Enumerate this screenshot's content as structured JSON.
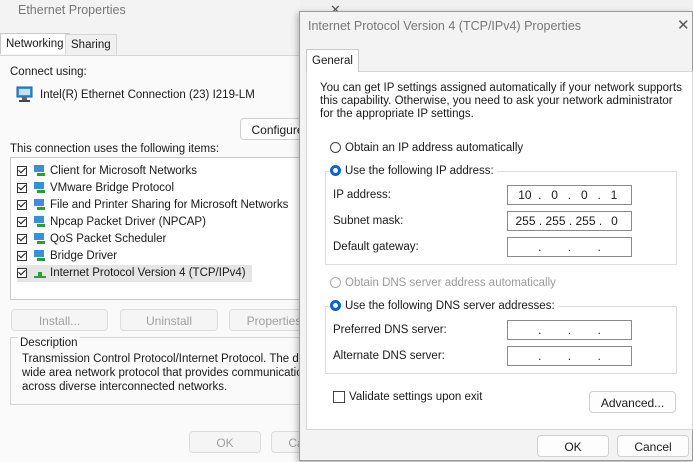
{
  "eth": {
    "title": "Ethernet Properties",
    "close_glyph": "✕",
    "tabs": [
      "Networking",
      "Sharing"
    ],
    "connect_using_label": "Connect using:",
    "adapter_name": "Intel(R) Ethernet Connection (23) I219-LM",
    "configure_label": "Configure",
    "items_label": "This connection uses the following items:",
    "items": [
      {
        "label": "Client for Microsoft Networks",
        "checked": true
      },
      {
        "label": "VMware Bridge Protocol",
        "checked": true
      },
      {
        "label": "File and Printer Sharing for Microsoft Networks",
        "checked": true
      },
      {
        "label": "Npcap Packet Driver (NPCAP)",
        "checked": true
      },
      {
        "label": "QoS Packet Scheduler",
        "checked": true
      },
      {
        "label": "Bridge Driver",
        "checked": true
      },
      {
        "label": "Internet Protocol Version 4 (TCP/IPv4)",
        "checked": true
      }
    ],
    "install_label": "Install...",
    "uninstall_label": "Uninstall",
    "properties_label": "Properties",
    "description_title": "Description",
    "description_lines": [
      "Transmission Control Protocol/Internet Protocol. The default",
      "wide area network protocol that provides communication",
      "across diverse interconnected networks."
    ],
    "ok_label": "OK",
    "cancel_label": "Cancel"
  },
  "ipv4": {
    "title": "Internet Protocol Version 4 (TCP/IPv4) Properties",
    "close_glyph": "✕",
    "tab_general": "General",
    "intro_lines": [
      "You can get IP settings assigned automatically if your network supports",
      "this capability. Otherwise, you need to ask your network administrator",
      "for the appropriate IP settings."
    ],
    "obtain_ip_auto_label": "Obtain an IP address automatically",
    "use_following_ip_label": "Use the following IP address:",
    "ip_mode": "manual",
    "ip_address_label": "IP address:",
    "ip_address": [
      "10",
      "0",
      "0",
      "1"
    ],
    "subnet_mask_label": "Subnet mask:",
    "subnet_mask": [
      "255",
      "255",
      "255",
      "0"
    ],
    "default_gateway_label": "Default gateway:",
    "default_gateway": [
      "",
      "",
      "",
      ""
    ],
    "obtain_dns_auto_label": "Obtain DNS server address automatically",
    "use_following_dns_label": "Use the following DNS server addresses:",
    "dns_mode": "manual",
    "preferred_dns_label": "Preferred DNS server:",
    "preferred_dns": [
      "",
      "",
      "",
      ""
    ],
    "alternate_dns_label": "Alternate DNS server:",
    "alternate_dns": [
      "",
      "",
      "",
      ""
    ],
    "validate_label": "Validate settings upon exit",
    "validate_checked": false,
    "advanced_label": "Advanced...",
    "ok_label": "OK",
    "cancel_label": "Cancel"
  }
}
